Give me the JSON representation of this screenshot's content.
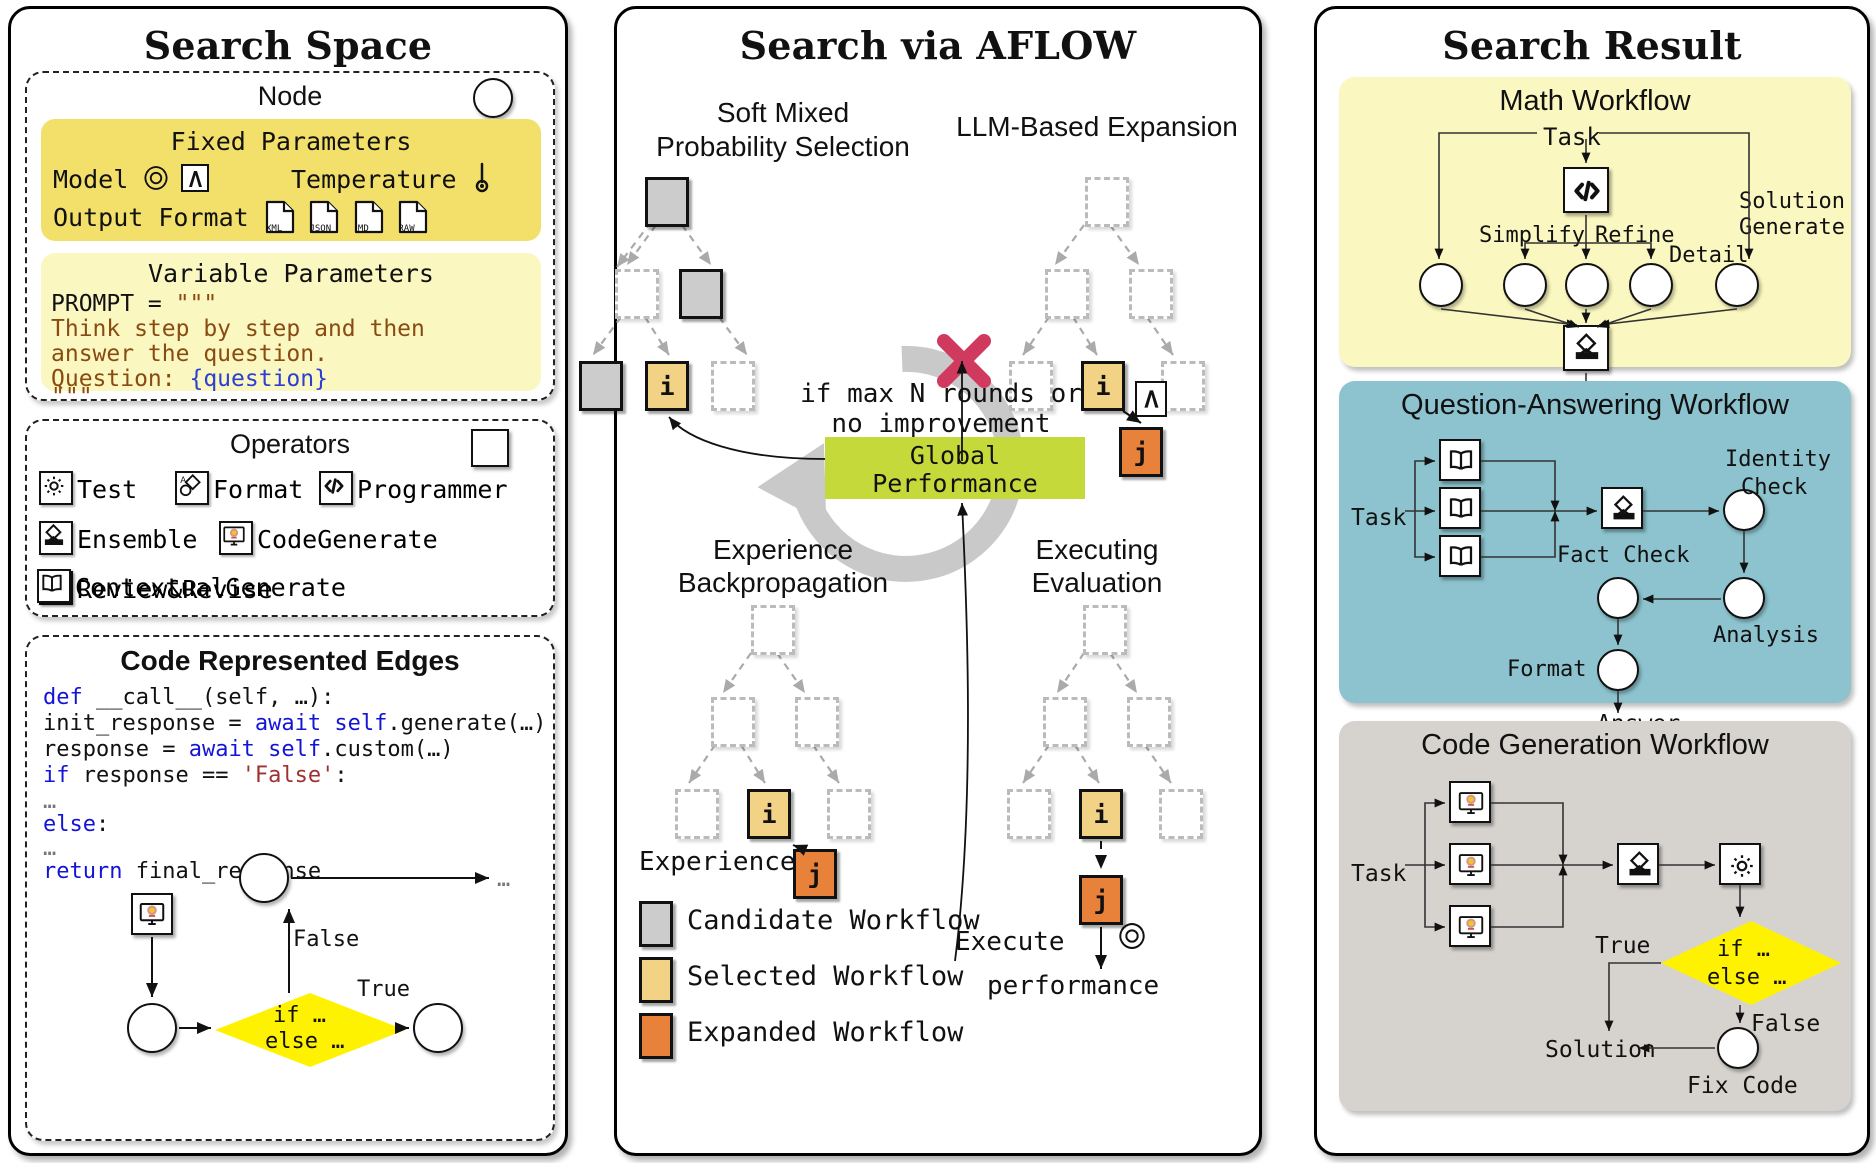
{
  "panels": {
    "left": {
      "title": "Search Space"
    },
    "mid": {
      "title": "Search via AFLOW"
    },
    "right": {
      "title": "Search Result"
    }
  },
  "search_space": {
    "node_card": {
      "title": "Node",
      "fixed": {
        "heading": "Fixed Parameters",
        "model_label": "Model",
        "temperature_label": "Temperature",
        "output_format_label": "Output Format",
        "formats": [
          "XML",
          "JSON",
          "MD",
          "RAW"
        ],
        "icons": [
          "openai-logo-icon",
          "anthropic-logo-icon",
          "thermometer-icon"
        ],
        "bg": "#F2E06B"
      },
      "variable": {
        "heading": "Variable Parameters",
        "bg": "#FAF7C0",
        "lines": [
          "PROMPT = \"\"\"",
          "Think step by step and then",
          "answer the question.",
          "Question: {question}",
          "\"\"\""
        ],
        "var_token": "{question}"
      }
    },
    "operators_card": {
      "title": "Operators",
      "items": [
        {
          "label": "Test",
          "icon": "gear-icon"
        },
        {
          "label": "Format",
          "icon": "format-shapes-icon"
        },
        {
          "label": "Programmer",
          "icon": "code-brackets-icon"
        },
        {
          "label": "Ensemble",
          "icon": "ensemble-stamp-icon"
        },
        {
          "label": "CodeGenerate",
          "icon": "monitor-bulb-icon"
        },
        {
          "label": "Review&Revise",
          "icon": "review-checklist-icon"
        },
        {
          "label": "ContextualGenerate",
          "icon": "open-book-icon"
        }
      ]
    },
    "edges_card": {
      "title": "Code Represented Edges",
      "code": [
        {
          "indent": 0,
          "parts": [
            {
              "t": "def ",
              "c": "kw"
            },
            {
              "t": "__call__(self, …):",
              "c": ""
            }
          ]
        },
        {
          "indent": 1,
          "parts": [
            {
              "t": "init_response = ",
              "c": ""
            },
            {
              "t": "await self",
              "c": "kw"
            },
            {
              "t": ".generate(…)",
              "c": ""
            }
          ]
        },
        {
          "indent": 1,
          "parts": [
            {
              "t": "response = ",
              "c": ""
            },
            {
              "t": "await self",
              "c": "kw"
            },
            {
              "t": ".custom(…)",
              "c": ""
            }
          ]
        },
        {
          "indent": 1,
          "parts": [
            {
              "t": "if",
              "c": "kw"
            },
            {
              "t": " response == ",
              "c": ""
            },
            {
              "t": "'False'",
              "c": "str"
            },
            {
              "t": ":",
              "c": ""
            }
          ]
        },
        {
          "indent": 2,
          "parts": [
            {
              "t": "…",
              "c": "gray9"
            }
          ]
        },
        {
          "indent": 1,
          "parts": [
            {
              "t": "else",
              "c": "kw"
            },
            {
              "t": ":",
              "c": ""
            }
          ]
        },
        {
          "indent": 2,
          "parts": [
            {
              "t": "…",
              "c": "gray9"
            }
          ]
        },
        {
          "indent": 1,
          "parts": [
            {
              "t": "return",
              "c": "kw"
            },
            {
              "t": " final_response",
              "c": ""
            }
          ]
        }
      ],
      "flow": {
        "icon": "monitor-bulb-icon",
        "diamond_line1": "if …",
        "diamond_line2": "else …",
        "false_label": "False",
        "true_label": "True",
        "ellipsis": "…"
      }
    }
  },
  "aflow": {
    "quadrants": [
      {
        "id": "soft-mixed",
        "line1": "Soft Mixed",
        "line2": "Probability Selection"
      },
      {
        "id": "llm-expand",
        "line1": "LLM-Based Expansion",
        "line2": ""
      },
      {
        "id": "experience",
        "line1": "Experience",
        "line2": "Backpropagation"
      },
      {
        "id": "evaluation",
        "line1": "Executing",
        "line2": "Evaluation"
      }
    ],
    "center": {
      "global_performance": "Global\nPerformance",
      "global_performance_l1": "Global",
      "global_performance_l2": "Performance",
      "stop_condition_l1": "if max N rounds or",
      "stop_condition_l2": "no improvement",
      "cross_icon": "red-cross-icon",
      "cycle_icon": "circular-arrow-icon",
      "bg": "#C5D93B"
    },
    "node_labels": {
      "selected": "i",
      "expanded": "j"
    },
    "annotations": {
      "experience": "Experience",
      "execute": "Execute",
      "performance": "performance",
      "expand_icon": "anthropic-logo-icon",
      "execute_icon": "openai-logo-icon"
    },
    "legend": [
      {
        "label": "Candidate Workflow",
        "color": "#CCCCCC"
      },
      {
        "label": "Selected Workflow",
        "color": "#F2D285"
      },
      {
        "label": "Expanded Workflow",
        "color": "#E8813A"
      }
    ]
  },
  "search_result": {
    "math": {
      "title": "Math Workflow",
      "bg": "#FAF7C0",
      "task": "Task",
      "solution": "Solution",
      "labels": [
        "Simplify",
        "Refine",
        "Detail",
        "Solution\nGenerate"
      ],
      "simplify": "Simplify",
      "refine": "Refine",
      "detail": "Detail",
      "sol_gen_l1": "Solution",
      "sol_gen_l2": "Generate",
      "icons": [
        "code-brackets-icon",
        "ensemble-stamp-icon"
      ],
      "circle_count": 5
    },
    "qa": {
      "title": "Question-Answering Workflow",
      "bg": "#8CC3CE",
      "task": "Task",
      "answer": "Answer",
      "identity_l1": "Identity",
      "identity_l2": "Check",
      "fact_check": "Fact Check",
      "analysis": "Analysis",
      "format": "Format",
      "icons": [
        "open-book-icon",
        "ensemble-stamp-icon"
      ],
      "book_count": 3
    },
    "code": {
      "title": "Code Generation Workflow",
      "bg": "#D6D3CE",
      "task": "Task",
      "solution": "Solution",
      "fix_code": "Fix Code",
      "true_label": "True",
      "false_label": "False",
      "diamond_l1": "if …",
      "diamond_l2": "else …",
      "icons": [
        "monitor-bulb-icon",
        "ensemble-stamp-icon",
        "gear-icon"
      ],
      "gen_count": 3
    }
  }
}
